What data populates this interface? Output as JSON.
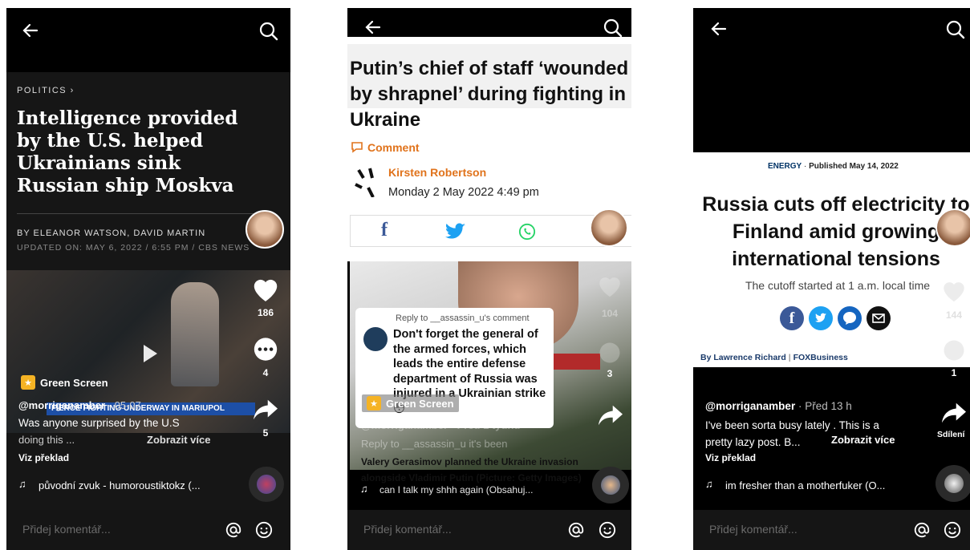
{
  "panel1": {
    "category": "POLITICS",
    "headline": "Intelligence provided by the U.S. helped Ukrainians sink Russian ship Moskva",
    "byline": "BY ELEANOR WATSON, DAVID MARTIN",
    "updated": "UPDATED ON: MAY 6, 2022 / 6:55 PM / CBS NEWS",
    "like_count": "186",
    "comment_count": "4",
    "share_count": "5",
    "green_screen": "Green Screen",
    "username": "@morriganamber",
    "date": " · 05-07",
    "caption": "Was anyone surprised by the U.S",
    "caption_more": "doing this ...",
    "see_more": "Zobrazit více",
    "translate": "Viz překlad",
    "video_chyron": "FIERCE FIGHTING UNDERWAY IN MARIUPOL",
    "sound": "původní zvuk - humoroustiktokz (...",
    "comment_placeholder": "Přidej komentář..."
  },
  "panel2": {
    "headline": "Putin’s chief of staff ‘wounded by shrapnel’ during fighting in Ukraine",
    "comment_link": "Comment",
    "author": "Kirsten Robertson",
    "date": "Monday 2 May 2022 4:49 pm",
    "reply_to": "Reply to __assassin_u's comment",
    "reply_text": "Don't forget the general of the armed forces, which leads the entire defense department of Russia was injured in a Ukrainian strike 😳",
    "like_count": "104",
    "comment_count": "3",
    "green_screen": "Green Screen",
    "username": "@morriganamber · Před 1 týdnu",
    "reply_line": "Reply to __assassin_u   it's been",
    "photo_caption": "Valery Gerasimov planned the Ukraine invasion alongside Vladimir Putin (Picture: Getty Images)",
    "sound": "can I talk my shhh again (Obsahuj...",
    "comment_placeholder": "Přidej komentář..."
  },
  "panel3": {
    "section": "ENERGY",
    "published": "Published May 14, 2022",
    "headline": "Russia cuts off electricity to Finland amid growing international tensions",
    "subhead": "The cutoff started at 1 a.m. local time",
    "byline_name": "By Lawrence Richard",
    "byline_outlet": "FOXBusiness",
    "like_count": "144",
    "comment_count": "1",
    "share_label": "Sdílení",
    "username": "@morriganamber",
    "time": " · Před 13 h",
    "caption": "I've been sorta busy lately . This is a pretty lazy post. B...",
    "see_more": "Zobrazit více",
    "translate": "Viz překlad",
    "sound": "im fresher than a motherfuker (O...",
    "comment_placeholder": "Přidej komentář..."
  }
}
